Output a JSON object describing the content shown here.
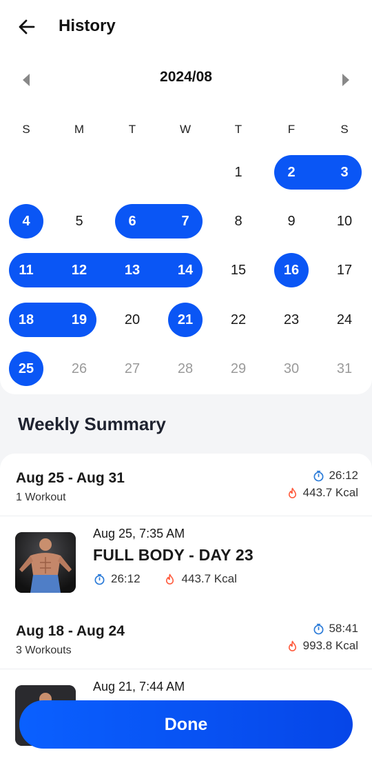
{
  "header": {
    "title": "History",
    "back_icon": "arrow-left-icon"
  },
  "calendar": {
    "month_label": "2024/08",
    "prev_icon": "triangle-left-icon",
    "next_icon": "triangle-right-icon",
    "weekdays": [
      "S",
      "M",
      "T",
      "W",
      "T",
      "F",
      "S"
    ],
    "accent": "#0a56f5",
    "selected_days": [
      2,
      3,
      4,
      6,
      7,
      11,
      12,
      13,
      14,
      16,
      18,
      19,
      21,
      25
    ],
    "future_days_from": 26,
    "days_in_month": 31,
    "first_weekday_index": 4
  },
  "weekly_summary": {
    "title": "Weekly Summary",
    "weeks": [
      {
        "range": "Aug 25 - Aug 31",
        "count": "1 Workout",
        "duration": "26:12",
        "calories": "443.7 Kcal",
        "workouts": [
          {
            "date": "Aug 25, 7:35 AM",
            "name": "FULL BODY - DAY 23",
            "duration": "26:12",
            "calories": "443.7 Kcal"
          }
        ]
      },
      {
        "range": "Aug 18 - Aug 24",
        "count": "3 Workouts",
        "duration": "58:41",
        "calories": "993.8 Kcal",
        "workouts": [
          {
            "date": "Aug 21, 7:44 AM"
          }
        ]
      }
    ]
  },
  "footer": {
    "done_label": "Done"
  },
  "colors": {
    "timer_icon": "#2b7bd8",
    "flame_icon": "#ff5a3c"
  }
}
